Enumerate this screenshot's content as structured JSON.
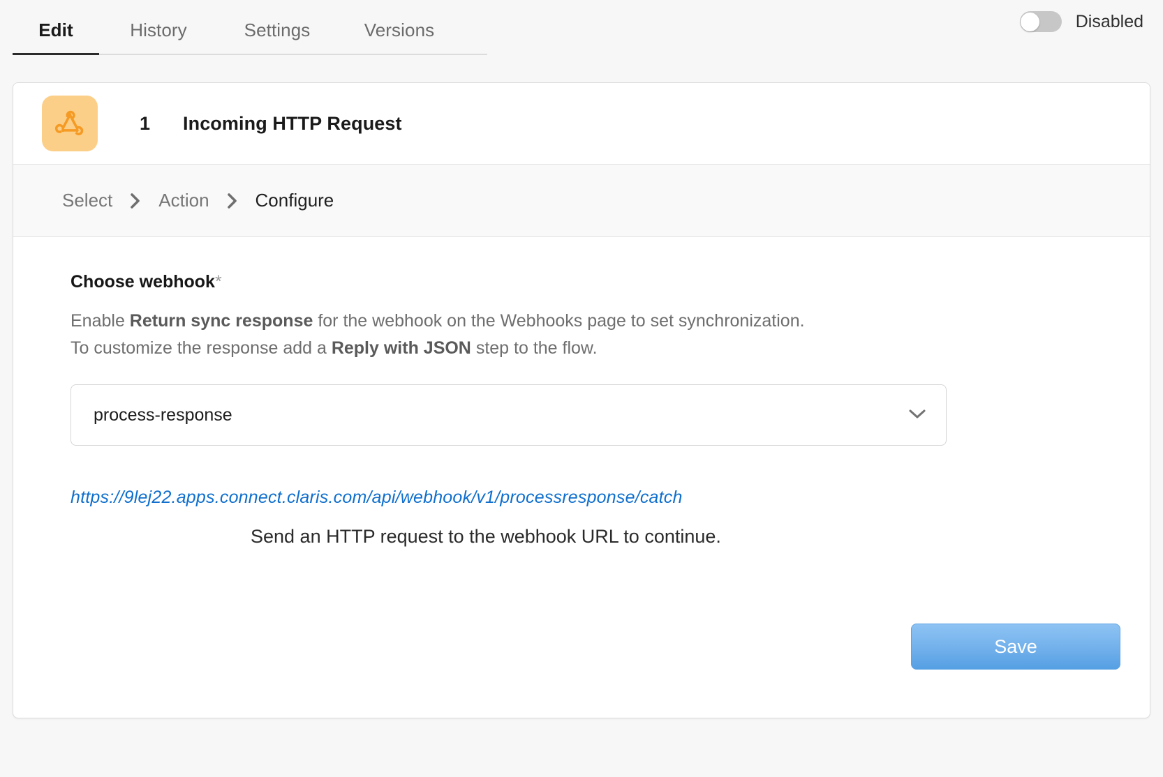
{
  "tabs": [
    {
      "label": "Edit",
      "active": true
    },
    {
      "label": "History",
      "active": false
    },
    {
      "label": "Settings",
      "active": false
    },
    {
      "label": "Versions",
      "active": false
    }
  ],
  "toggle": {
    "label": "Disabled",
    "state": "off"
  },
  "step": {
    "number": "1",
    "title": "Incoming HTTP Request",
    "icon": "webhook-icon",
    "icon_bg": "#fccf88",
    "icon_color": "#f59a23"
  },
  "breadcrumb": {
    "items": [
      "Select",
      "Action",
      "Configure"
    ],
    "current": "Configure"
  },
  "form": {
    "label": "Choose webhook",
    "required_mark": "*",
    "description_line1_a": "Enable ",
    "description_line1_b": "Return sync response",
    "description_line1_c": " for the webhook on the Webhooks page to set synchronization.",
    "description_line2_a": "To customize the response add a ",
    "description_line2_b": "Reply with JSON",
    "description_line2_c": " step to the flow.",
    "select_value": "process-response",
    "select_icon": "chevron-down-icon",
    "webhook_url": "https://9lej22.apps.connect.claris.com/api/webhook/v1/processresponse/catch",
    "hint": "Send an HTTP request to the webhook URL to continue."
  },
  "annotation": {
    "type": "arrow-left",
    "color": "#f72c5b"
  },
  "actions": {
    "save_label": "Save",
    "save_color": "#74b2ec"
  }
}
